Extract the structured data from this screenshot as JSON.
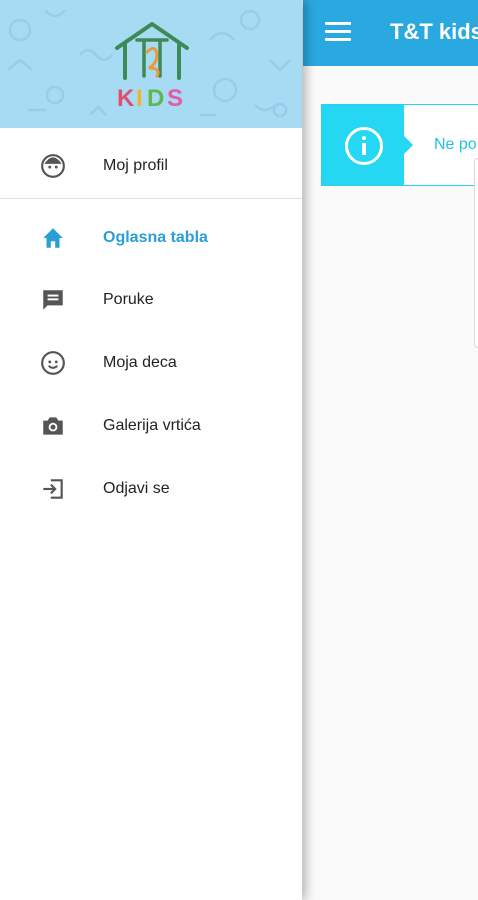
{
  "appbar": {
    "title": "T&T kids",
    "menu_icon": "hamburger-icon",
    "background": "#2aa8e0"
  },
  "notice": {
    "icon": "info-icon",
    "text": "Ne po",
    "accent": "#25d7f2"
  },
  "drawer": {
    "logo_text": "KIDS",
    "header_background": "#a7daf3",
    "profile": {
      "label": "Moj profil",
      "icon": "face-icon"
    },
    "items": [
      {
        "label": "Oglasna tabla",
        "icon": "home-icon",
        "active": true
      },
      {
        "label": "Poruke",
        "icon": "message-icon",
        "active": false
      },
      {
        "label": "Moja deca",
        "icon": "child-face-icon",
        "active": false
      },
      {
        "label": "Galerija vrtića",
        "icon": "camera-icon",
        "active": false
      },
      {
        "label": "Odjavi se",
        "icon": "logout-icon",
        "active": false
      }
    ],
    "active_color": "#2a9fd6"
  }
}
